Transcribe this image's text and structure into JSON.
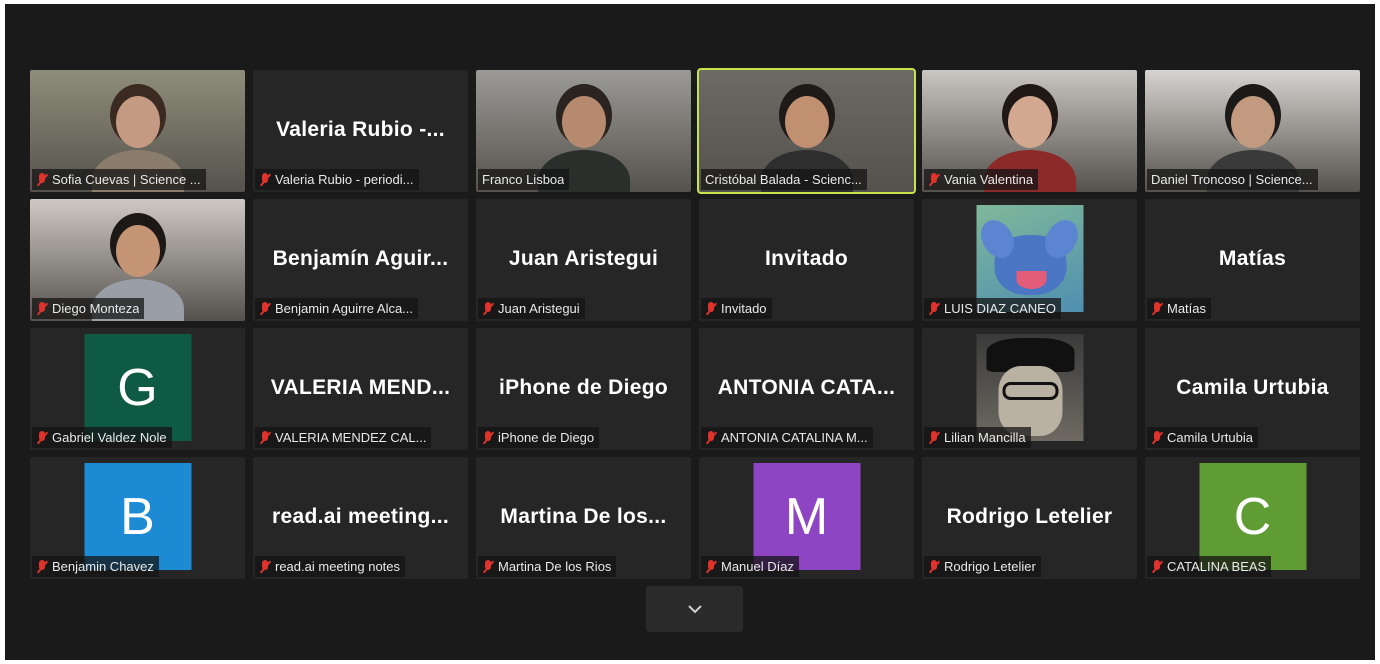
{
  "participants": [
    {
      "label": "Sofia Cuevas | Science ...",
      "muted": true,
      "display": "video",
      "skin": "#c49a82",
      "hair": "#3b2a22",
      "shirt": "#8a7d6c",
      "bg": "#8f8d7a"
    },
    {
      "label": "Valeria Rubio - periodi...",
      "muted": true,
      "display": "name",
      "big_name": "Valeria  Rubio  -..."
    },
    {
      "label": "Franco Lisboa",
      "muted": false,
      "display": "video",
      "skin": "#b58a6e",
      "hair": "#2a2320",
      "shirt": "#2b2f2c",
      "bg": "#9b9a96"
    },
    {
      "label": "Cristóbal Balada - Scienc...",
      "muted": false,
      "display": "video",
      "active": true,
      "skin": "#c09070",
      "hair": "#1e1a18",
      "shirt": "#2e2e2e",
      "bg": "#6c6a65"
    },
    {
      "label": "Vania Valentina",
      "muted": true,
      "display": "video",
      "skin": "#d2a890",
      "hair": "#1f1815",
      "shirt": "#8c2a2a",
      "bg": "#c9c6c2"
    },
    {
      "label": "Daniel Troncoso | Science...",
      "muted": false,
      "display": "video",
      "skin": "#c29a80",
      "hair": "#1c1a19",
      "shirt": "#3a3a3a",
      "bg": "#d6d4d0"
    },
    {
      "label": "Diego Monteza",
      "muted": true,
      "display": "video",
      "skin": "#c49474",
      "hair": "#1b1815",
      "shirt": "#9a9ea6",
      "bg": "#cfc9c5"
    },
    {
      "label": "Benjamin Aguirre Alca...",
      "muted": true,
      "display": "name",
      "big_name": "Benjamín  Aguir..."
    },
    {
      "label": "Juan Aristegui",
      "muted": true,
      "display": "name",
      "big_name": "Juan Aristegui"
    },
    {
      "label": "Invitado",
      "muted": true,
      "display": "name",
      "big_name": "Invitado"
    },
    {
      "label": "LUIS DIAZ CANEO",
      "muted": true,
      "display": "picture",
      "picture": "stitch"
    },
    {
      "label": "Matías",
      "muted": true,
      "display": "name",
      "big_name": "Matías"
    },
    {
      "label": "Gabriel Valdez Nole",
      "muted": true,
      "display": "avatar",
      "letter": "G",
      "color": "#0e5a43"
    },
    {
      "label": "VALERIA MENDEZ CAL...",
      "muted": true,
      "display": "name",
      "big_name": "VALERIA  MEND..."
    },
    {
      "label": "iPhone de Diego",
      "muted": true,
      "display": "name",
      "big_name": "iPhone de Diego"
    },
    {
      "label": "ANTONIA CATALINA M...",
      "muted": true,
      "display": "name",
      "big_name": "ANTONIA  CATA..."
    },
    {
      "label": "Lilian Mancilla",
      "muted": true,
      "display": "picture",
      "picture": "cartoon"
    },
    {
      "label": "Camila Urtubia",
      "muted": true,
      "display": "name",
      "big_name": "Camila Urtubia"
    },
    {
      "label": "Benjamin Chavez",
      "muted": true,
      "display": "avatar",
      "letter": "B",
      "color": "#1c8bd4"
    },
    {
      "label": "read.ai meeting notes",
      "muted": true,
      "display": "name",
      "big_name": "read.ai  meeting..."
    },
    {
      "label": "Martina De los Rios",
      "muted": true,
      "display": "name",
      "big_name": "Martina  De  los..."
    },
    {
      "label": "Manuel Díaz",
      "muted": true,
      "display": "avatar",
      "letter": "M",
      "color": "#8e45c4"
    },
    {
      "label": "Rodrigo Letelier",
      "muted": true,
      "display": "name",
      "big_name": "Rodrigo Letelier"
    },
    {
      "label": "CATALINA BEAS",
      "muted": true,
      "display": "avatar",
      "letter": "C",
      "color": "#5f9c33"
    }
  ],
  "controls": {
    "more_icon": "chevron-down-icon"
  }
}
